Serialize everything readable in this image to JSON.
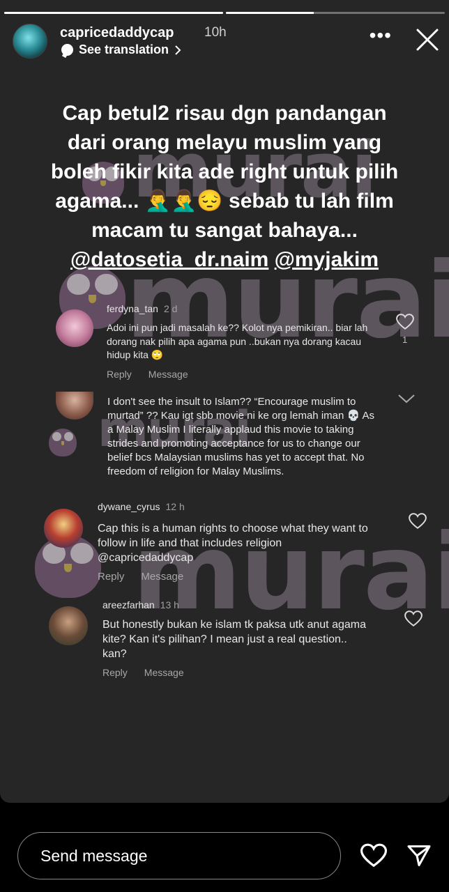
{
  "story": {
    "progress": [
      1.0,
      0.4
    ],
    "username": "capricedaddycap",
    "time": "10h",
    "see_translation": "See translation",
    "more_icon": "more-icon",
    "caption_lines": [
      "Cap betul2 risau dgn pandangan",
      "dari orang melayu muslim yang",
      "boleh fikir kita ade right untuk pilih",
      "agama... 🤦‍♂️🤦‍♂️😔 sebab tu lah film",
      "macam tu sangat bahaya..."
    ],
    "mention_1": "@datosetia_dr.naim",
    "mention_2": "@myjakim",
    "watermark": "murai"
  },
  "comments": [
    {
      "user": "ferdyna_tan",
      "age": "2 d",
      "text": "Adoi ini pun jadi masalah ke?? Kolot nya pemikiran.. biar lah dorang nak pilih apa agama pun ..bukan nya dorang kacau hidup kita 🙄",
      "reply": "Reply",
      "message": "Message",
      "likes": "1"
    },
    {
      "user": "",
      "age": "",
      "text": "I don't see the insult to Islam?? “Encourage muslim to murtad” ?? Kau igt sbb movie ni ke org lemah iman 💀 As a Malay Muslim I literally applaud this movie to taking strides and promoting acceptance for us to change our belief bcs Malaysian muslims has yet to accept that. No freedom of religion for Malay Muslims.",
      "reply": "",
      "message": "",
      "likes": ""
    },
    {
      "user": "dywane_cyrus",
      "age": "12 h",
      "text": "Cap this is a human rights to choose what they want to follow in life and that includes religion @capricedaddycap",
      "reply": "Reply",
      "message": "Message",
      "likes": ""
    },
    {
      "user": "areezfarhan",
      "age": "13 h",
      "text": "But honestly bukan ke islam tk paksa utk anut agama kite? Kan it's pilihan? I mean just a real question.. kan?",
      "reply": "Reply",
      "message": "Message",
      "likes": ""
    }
  ],
  "footer": {
    "placeholder": "Send message"
  },
  "colors": {
    "story_bg": "#262626",
    "footer_bg": "#000000",
    "text": "#ffffff",
    "secondary": "#a8a8a8"
  }
}
